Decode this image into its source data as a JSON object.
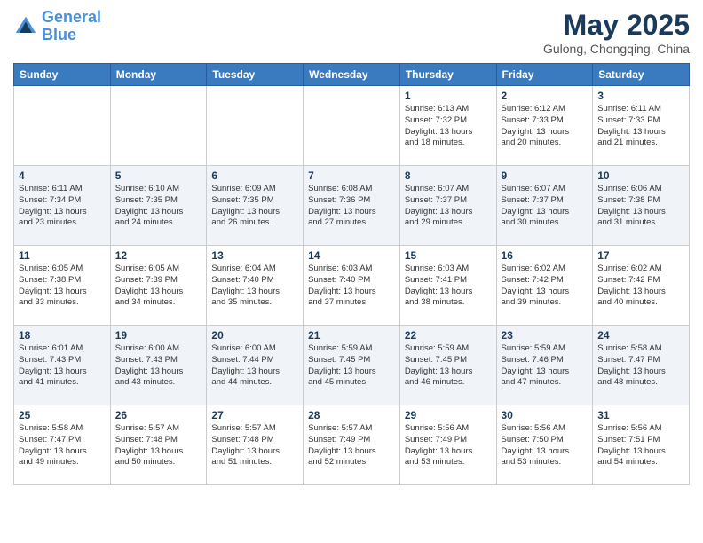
{
  "header": {
    "logo_line1": "General",
    "logo_line2": "Blue",
    "month": "May 2025",
    "location": "Gulong, Chongqing, China"
  },
  "weekdays": [
    "Sunday",
    "Monday",
    "Tuesday",
    "Wednesday",
    "Thursday",
    "Friday",
    "Saturday"
  ],
  "weeks": [
    [
      {
        "day": "",
        "info": ""
      },
      {
        "day": "",
        "info": ""
      },
      {
        "day": "",
        "info": ""
      },
      {
        "day": "",
        "info": ""
      },
      {
        "day": "1",
        "info": "Sunrise: 6:13 AM\nSunset: 7:32 PM\nDaylight: 13 hours\nand 18 minutes."
      },
      {
        "day": "2",
        "info": "Sunrise: 6:12 AM\nSunset: 7:33 PM\nDaylight: 13 hours\nand 20 minutes."
      },
      {
        "day": "3",
        "info": "Sunrise: 6:11 AM\nSunset: 7:33 PM\nDaylight: 13 hours\nand 21 minutes."
      }
    ],
    [
      {
        "day": "4",
        "info": "Sunrise: 6:11 AM\nSunset: 7:34 PM\nDaylight: 13 hours\nand 23 minutes."
      },
      {
        "day": "5",
        "info": "Sunrise: 6:10 AM\nSunset: 7:35 PM\nDaylight: 13 hours\nand 24 minutes."
      },
      {
        "day": "6",
        "info": "Sunrise: 6:09 AM\nSunset: 7:35 PM\nDaylight: 13 hours\nand 26 minutes."
      },
      {
        "day": "7",
        "info": "Sunrise: 6:08 AM\nSunset: 7:36 PM\nDaylight: 13 hours\nand 27 minutes."
      },
      {
        "day": "8",
        "info": "Sunrise: 6:07 AM\nSunset: 7:37 PM\nDaylight: 13 hours\nand 29 minutes."
      },
      {
        "day": "9",
        "info": "Sunrise: 6:07 AM\nSunset: 7:37 PM\nDaylight: 13 hours\nand 30 minutes."
      },
      {
        "day": "10",
        "info": "Sunrise: 6:06 AM\nSunset: 7:38 PM\nDaylight: 13 hours\nand 31 minutes."
      }
    ],
    [
      {
        "day": "11",
        "info": "Sunrise: 6:05 AM\nSunset: 7:38 PM\nDaylight: 13 hours\nand 33 minutes."
      },
      {
        "day": "12",
        "info": "Sunrise: 6:05 AM\nSunset: 7:39 PM\nDaylight: 13 hours\nand 34 minutes."
      },
      {
        "day": "13",
        "info": "Sunrise: 6:04 AM\nSunset: 7:40 PM\nDaylight: 13 hours\nand 35 minutes."
      },
      {
        "day": "14",
        "info": "Sunrise: 6:03 AM\nSunset: 7:40 PM\nDaylight: 13 hours\nand 37 minutes."
      },
      {
        "day": "15",
        "info": "Sunrise: 6:03 AM\nSunset: 7:41 PM\nDaylight: 13 hours\nand 38 minutes."
      },
      {
        "day": "16",
        "info": "Sunrise: 6:02 AM\nSunset: 7:42 PM\nDaylight: 13 hours\nand 39 minutes."
      },
      {
        "day": "17",
        "info": "Sunrise: 6:02 AM\nSunset: 7:42 PM\nDaylight: 13 hours\nand 40 minutes."
      }
    ],
    [
      {
        "day": "18",
        "info": "Sunrise: 6:01 AM\nSunset: 7:43 PM\nDaylight: 13 hours\nand 41 minutes."
      },
      {
        "day": "19",
        "info": "Sunrise: 6:00 AM\nSunset: 7:43 PM\nDaylight: 13 hours\nand 43 minutes."
      },
      {
        "day": "20",
        "info": "Sunrise: 6:00 AM\nSunset: 7:44 PM\nDaylight: 13 hours\nand 44 minutes."
      },
      {
        "day": "21",
        "info": "Sunrise: 5:59 AM\nSunset: 7:45 PM\nDaylight: 13 hours\nand 45 minutes."
      },
      {
        "day": "22",
        "info": "Sunrise: 5:59 AM\nSunset: 7:45 PM\nDaylight: 13 hours\nand 46 minutes."
      },
      {
        "day": "23",
        "info": "Sunrise: 5:59 AM\nSunset: 7:46 PM\nDaylight: 13 hours\nand 47 minutes."
      },
      {
        "day": "24",
        "info": "Sunrise: 5:58 AM\nSunset: 7:47 PM\nDaylight: 13 hours\nand 48 minutes."
      }
    ],
    [
      {
        "day": "25",
        "info": "Sunrise: 5:58 AM\nSunset: 7:47 PM\nDaylight: 13 hours\nand 49 minutes."
      },
      {
        "day": "26",
        "info": "Sunrise: 5:57 AM\nSunset: 7:48 PM\nDaylight: 13 hours\nand 50 minutes."
      },
      {
        "day": "27",
        "info": "Sunrise: 5:57 AM\nSunset: 7:48 PM\nDaylight: 13 hours\nand 51 minutes."
      },
      {
        "day": "28",
        "info": "Sunrise: 5:57 AM\nSunset: 7:49 PM\nDaylight: 13 hours\nand 52 minutes."
      },
      {
        "day": "29",
        "info": "Sunrise: 5:56 AM\nSunset: 7:49 PM\nDaylight: 13 hours\nand 53 minutes."
      },
      {
        "day": "30",
        "info": "Sunrise: 5:56 AM\nSunset: 7:50 PM\nDaylight: 13 hours\nand 53 minutes."
      },
      {
        "day": "31",
        "info": "Sunrise: 5:56 AM\nSunset: 7:51 PM\nDaylight: 13 hours\nand 54 minutes."
      }
    ]
  ]
}
